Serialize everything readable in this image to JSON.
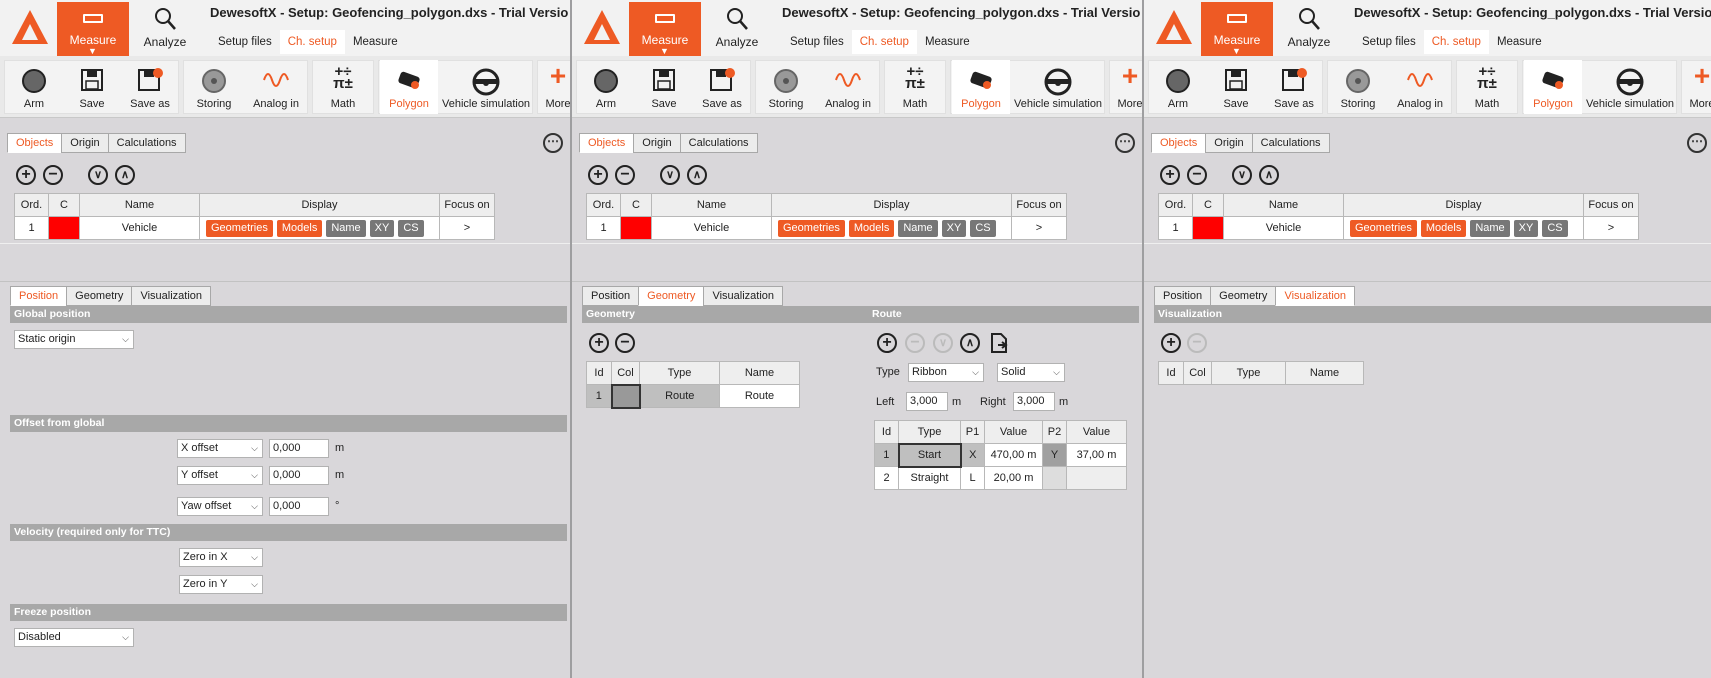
{
  "app": {
    "title": "DewesoftX - Setup: Geofencing_polygon.dxs - Trial Versio",
    "measure_label": "Measure",
    "analyze_label": "Analyze",
    "subtabs": [
      "Setup files",
      "Ch. setup",
      "Measure"
    ],
    "active_subtab": "Ch. setup"
  },
  "toolbar": {
    "arm": "Arm",
    "save": "Save",
    "save_as": "Save as",
    "storing": "Storing",
    "analog_in": "Analog in",
    "math": "Math",
    "polygon": "Polygon",
    "vehicle_sim": "Vehicle simulation",
    "more": "More"
  },
  "top_tabs": [
    "Objects",
    "Origin",
    "Calculations"
  ],
  "objects": {
    "headers": [
      "Ord.",
      "C",
      "Name",
      "Display",
      "Focus on"
    ],
    "row": {
      "ord": "1",
      "color": "#ff0000",
      "name": "Vehicle",
      "chips": [
        "Geometries",
        "Models",
        "Name",
        "XY",
        "CS"
      ],
      "focus": ">"
    }
  },
  "bottom_tabs": [
    "Position",
    "Geometry",
    "Visualization"
  ],
  "position": {
    "global_section": "Global position",
    "global_value": "Static origin",
    "offset_section": "Offset from global",
    "x_offset_label": "X offset",
    "x_offset_value": "0,000",
    "x_offset_unit": "m",
    "y_offset_label": "Y offset",
    "y_offset_value": "0,000",
    "y_offset_unit": "m",
    "yaw_offset_label": "Yaw offset",
    "yaw_offset_value": "0,000",
    "yaw_offset_unit": "°",
    "velocity_section": "Velocity (required only for TTC)",
    "vel_x": "Zero in X",
    "vel_y": "Zero in Y",
    "freeze_section": "Freeze position",
    "freeze_value": "Disabled"
  },
  "geometry": {
    "section": "Geometry",
    "headers": [
      "Id",
      "Col",
      "Type",
      "Name"
    ],
    "row": {
      "id": "1",
      "type": "Route",
      "name": "Route"
    },
    "route_section": "Route",
    "type_label": "Type",
    "type_value": "Ribbon",
    "style_value": "Solid",
    "left_label": "Left",
    "left_value": "3,000",
    "left_unit": "m",
    "right_label": "Right",
    "right_value": "3,000",
    "right_unit": "m",
    "route_headers": [
      "Id",
      "Type",
      "P1",
      "Value",
      "P2",
      "Value"
    ],
    "route_rows": [
      {
        "id": "1",
        "type": "Start",
        "p1": "X",
        "v1": "470,00 m",
        "p2": "Y",
        "v2": "37,00 m"
      },
      {
        "id": "2",
        "type": "Straight",
        "p1": "L",
        "v1": "20,00 m",
        "p2": "",
        "v2": ""
      }
    ]
  },
  "visualization": {
    "section": "Visualization",
    "headers": [
      "Id",
      "Col",
      "Type",
      "Name"
    ]
  },
  "colors": {
    "accent": "#ee5a24",
    "section": "#a8a8a8",
    "panel": "#d9d7da"
  }
}
